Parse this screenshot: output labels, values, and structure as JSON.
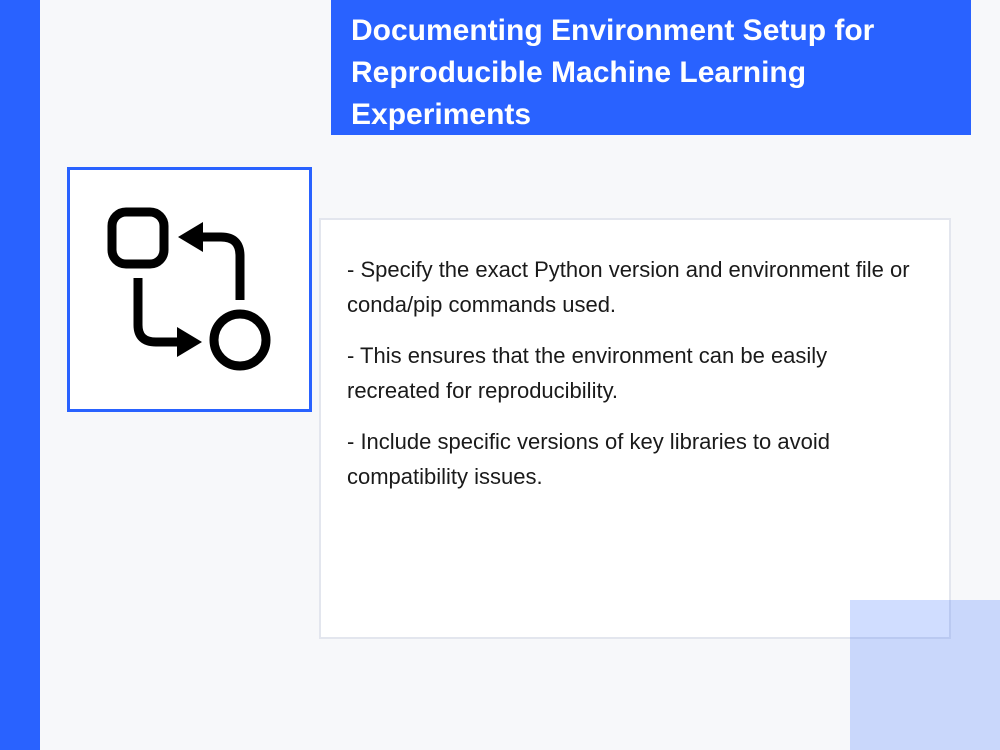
{
  "slide": {
    "title": "Documenting Environment Setup for Reproducible Machine Learning Experiments",
    "icon": "workflow-cycle-icon",
    "bullets": [
      "- Specify the exact Python version and environment file or conda/pip commands used.",
      "- This ensures that the environment can be easily recreated for reproducibility.",
      "- Include specific versions of key libraries to avoid compatibility issues."
    ]
  },
  "colors": {
    "accent": "#2962ff",
    "background": "#f7f8fa",
    "text": "#1a1a1a",
    "icon": "#000000"
  }
}
